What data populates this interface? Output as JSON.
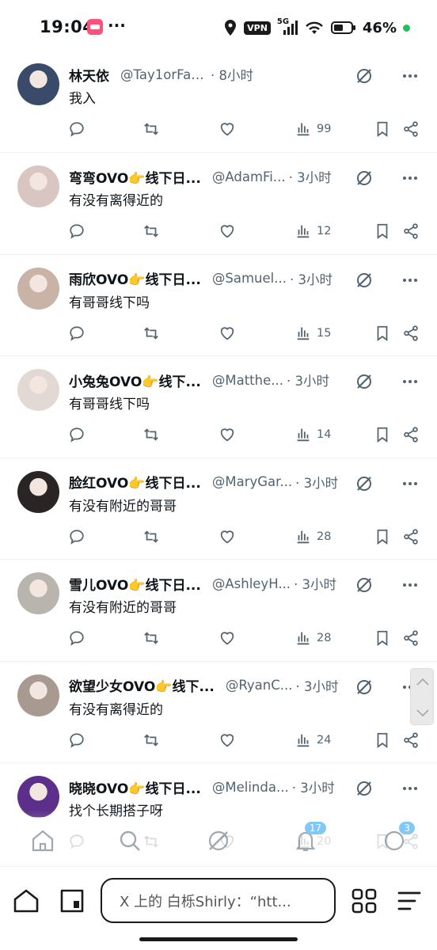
{
  "status_bar": {
    "time": "19:04",
    "dots": "···",
    "vpn": "VPN",
    "network": "5G",
    "battery": "46%"
  },
  "tweets": [
    {
      "name": "林天依",
      "handle": "@Tay1orFaNs",
      "time": "· 8小时",
      "text": "我入",
      "views": "99",
      "avatar_color": "#3a4a6b"
    },
    {
      "name": "弯弯OVO👉线下日...",
      "handle": "@AdamFi...",
      "time": "· 3小时",
      "text": "有没有离得近的",
      "views": "12",
      "avatar_color": "#d9c6c2"
    },
    {
      "name": "雨欣OVO👉线下日...",
      "handle": "@Samuel...",
      "time": "· 3小时",
      "text": "有哥哥线下吗",
      "views": "15",
      "avatar_color": "#c9b2a6"
    },
    {
      "name": "小兔兔OVO👉线下...",
      "handle": "@Matthe...",
      "time": "· 3小时",
      "text": "有哥哥线下吗",
      "views": "14",
      "avatar_color": "#e3d9d4"
    },
    {
      "name": "脸红OVO👉线下日...",
      "handle": "@MaryGar...",
      "time": "· 3小时",
      "text": "有没有附近的哥哥",
      "views": "28",
      "avatar_color": "#2b2424"
    },
    {
      "name": "雪儿OVO👉线下日...",
      "handle": "@AshleyH...",
      "time": "· 3小时",
      "text": "有没有附近的哥哥",
      "views": "28",
      "avatar_color": "#b9b4ae"
    },
    {
      "name": "欲望少女OVO👉线下...",
      "handle": "@RyanC...",
      "time": "· 3小时",
      "text": "有没有离得近的",
      "views": "24",
      "avatar_color": "#a89a90"
    },
    {
      "name": "晓晓OVO👉线下日...",
      "handle": "@Melinda...",
      "time": "· 3小时",
      "text": "找个长期搭子呀",
      "views": "20",
      "avatar_color": "#5b2f8a"
    }
  ],
  "x_nav": {
    "notifications_badge": "17",
    "messages_badge": "3"
  },
  "browser": {
    "url_text": "X 上的 白栎Shirly：“htt..."
  },
  "colors": {
    "icon_gray": "#536471",
    "text": "#0f1419",
    "accent": "#1d9bf0"
  }
}
